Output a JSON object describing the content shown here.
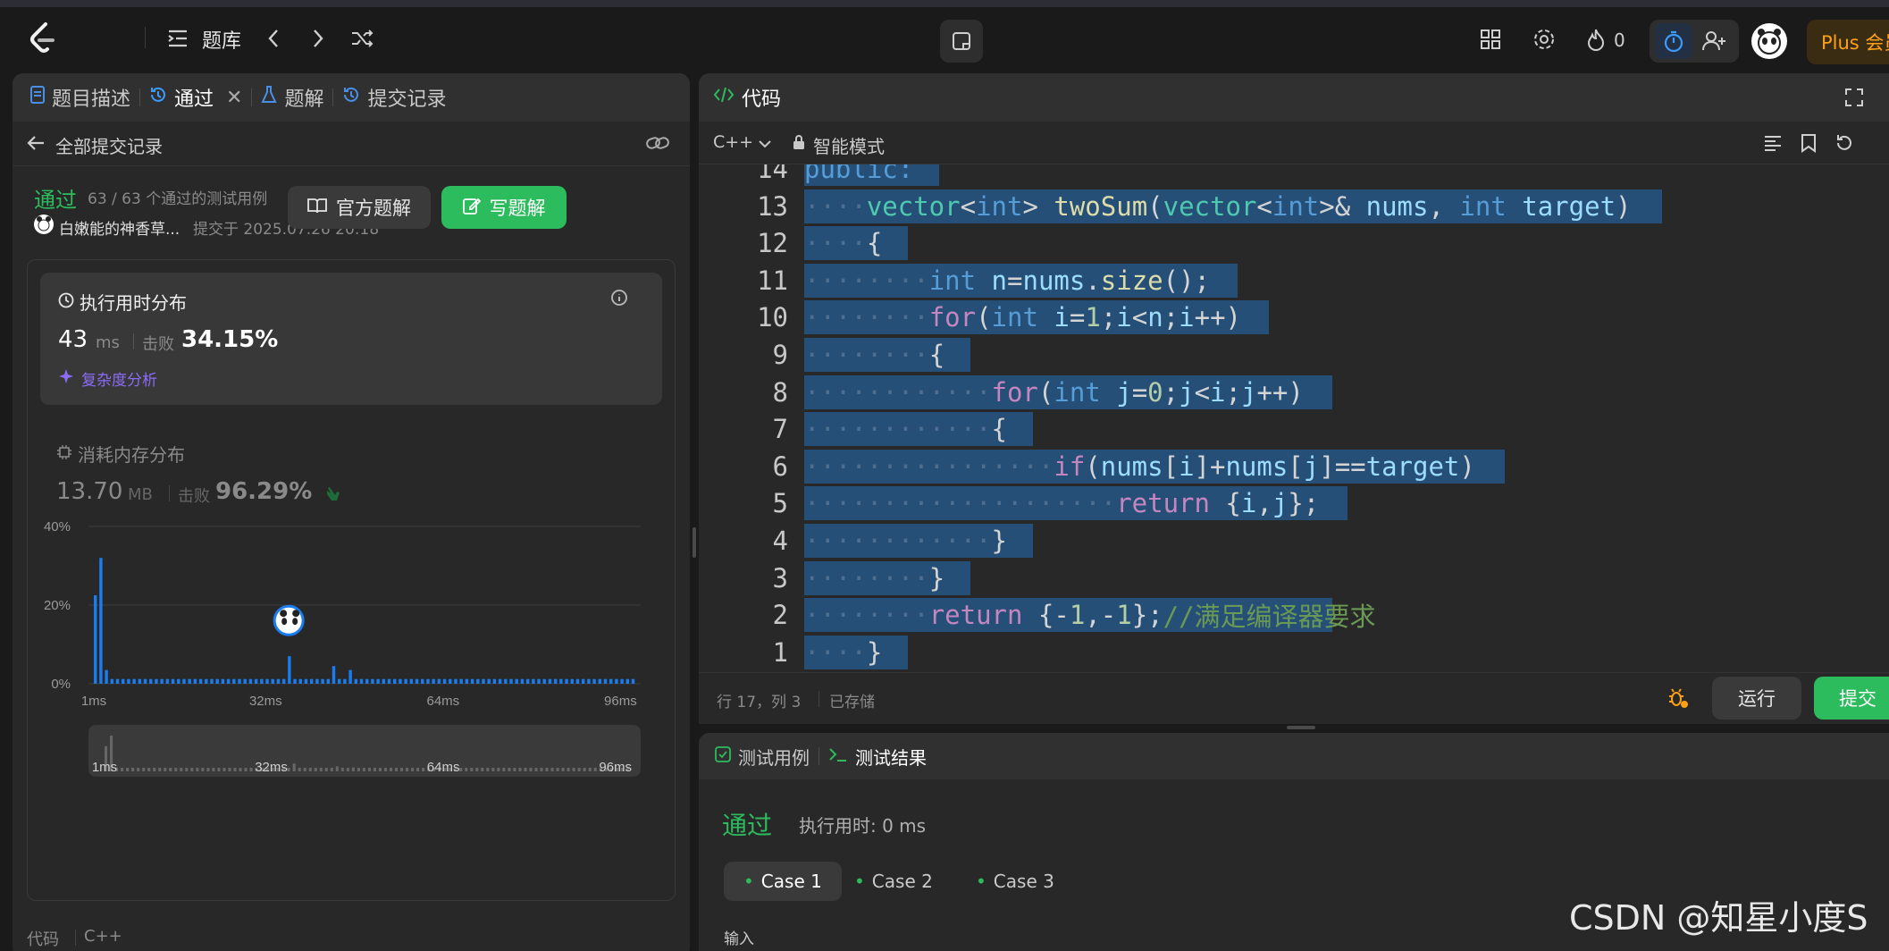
{
  "nav": {
    "problem_bank": "题库",
    "fire_count": "0",
    "plus": "Plus 会员"
  },
  "left": {
    "tabs": {
      "description": "题目描述",
      "accepted": "通过",
      "solutions": "题解",
      "submissions": "提交记录"
    },
    "back_label": "全部提交记录",
    "status": "通过",
    "cases_passed": "63 / 63 个通过的测试用例",
    "user": "白嫩能的神香草...",
    "submitted_at": "提交于 2025.07.26 20:18",
    "official_solution": "官方题解",
    "write_solution": "写题解",
    "runtime": {
      "title": "执行用时分布",
      "value": "43",
      "unit": "ms",
      "beats_label": "击败",
      "beats": "34.15%",
      "analysis": "复杂度分析"
    },
    "memory": {
      "title": "消耗内存分布",
      "value": "13.70",
      "unit": "MB",
      "beats_label": "击败",
      "beats": "96.29%"
    },
    "bottom_code_label": "代码",
    "bottom_lang": "C++"
  },
  "chart_data": {
    "type": "bar",
    "title": "执行用时分布",
    "yticks": [
      "40%",
      "20%",
      "0%"
    ],
    "xticks": [
      "1ms",
      "32ms",
      "64ms",
      "96ms"
    ],
    "ylim": [
      0,
      40
    ],
    "values": [
      22.5,
      32,
      3.5,
      1.2,
      1.2,
      1.2,
      1.2,
      1.2,
      1.2,
      1.2,
      1.2,
      1.2,
      1.2,
      1.2,
      1.2,
      1.2,
      1.2,
      1.2,
      1.2,
      1.2,
      1.2,
      1.2,
      1.2,
      1.2,
      1.2,
      1.2,
      1.2,
      1.2,
      1.2,
      1.2,
      1.2,
      1.2,
      1.2,
      1.2,
      1.2,
      7,
      1.2,
      1.2,
      1.2,
      1.2,
      1.2,
      1.2,
      1.2,
      4.5,
      1.2,
      1.2,
      3.5,
      1.2,
      1.2,
      1.2,
      1.2,
      1.2,
      1.2,
      1.2,
      1.2,
      1.2,
      1.2,
      1.2,
      1.2,
      1.2,
      1.2,
      1.2,
      1.2,
      1.2,
      1.2,
      1.2,
      1.2,
      1.2,
      1.2,
      1.2,
      1.2,
      1.2,
      1.2,
      1.2,
      1.2,
      1.2,
      1.2,
      1.2,
      1.2,
      1.2,
      1.2,
      1.2,
      1.2,
      1.2,
      1.2,
      1.2,
      1.2,
      1.2,
      1.2,
      1.2,
      1.2,
      1.2,
      1.2,
      1.2,
      1.2,
      1.2,
      1.2,
      1.2
    ],
    "highlight_index": 35,
    "colors": {
      "bar": "#1b7cf0",
      "grid": "#3d3d3d"
    }
  },
  "code": {
    "title": "代码",
    "lang": "C++",
    "mode": "智能模式",
    "lines": [
      {
        "n": "14",
        "indent": 0,
        "tokens": [
          [
            "kw",
            "public:"
          ]
        ]
      },
      {
        "n": "13",
        "indent": 1,
        "tokens": [
          [
            "tp",
            "vector"
          ],
          [
            "pl",
            "<"
          ],
          [
            "kw",
            "int"
          ],
          [
            "pl",
            "> "
          ],
          [
            "fn",
            "twoSum"
          ],
          [
            "pl",
            "("
          ],
          [
            "tp",
            "vector"
          ],
          [
            "pl",
            "<"
          ],
          [
            "kw",
            "int"
          ],
          [
            "pl",
            ">& "
          ],
          [
            "vr",
            "nums"
          ],
          [
            "pl",
            ", "
          ],
          [
            "kw",
            "int"
          ],
          [
            "pl",
            " "
          ],
          [
            "vr",
            "target"
          ],
          [
            "pl",
            ")"
          ]
        ]
      },
      {
        "n": "12",
        "indent": 1,
        "tokens": [
          [
            "pl",
            "{"
          ]
        ]
      },
      {
        "n": "11",
        "indent": 2,
        "tokens": [
          [
            "kw",
            "int"
          ],
          [
            "pl",
            " "
          ],
          [
            "vr",
            "n"
          ],
          [
            "pl",
            "="
          ],
          [
            "vr",
            "nums"
          ],
          [
            "pl",
            "."
          ],
          [
            "fn",
            "size"
          ],
          [
            "pl",
            "();"
          ]
        ]
      },
      {
        "n": "10",
        "indent": 2,
        "tokens": [
          [
            "ctl",
            "for"
          ],
          [
            "pl",
            "("
          ],
          [
            "kw",
            "int"
          ],
          [
            "pl",
            " "
          ],
          [
            "vr",
            "i"
          ],
          [
            "pl",
            "="
          ],
          [
            "num",
            "1"
          ],
          [
            "pl",
            ";"
          ],
          [
            "vr",
            "i"
          ],
          [
            "pl",
            "<"
          ],
          [
            "vr",
            "n"
          ],
          [
            "pl",
            ";"
          ],
          [
            "vr",
            "i"
          ],
          [
            "pl",
            "++)"
          ]
        ]
      },
      {
        "n": "9",
        "indent": 2,
        "tokens": [
          [
            "pl",
            "{"
          ]
        ]
      },
      {
        "n": "8",
        "indent": 3,
        "tokens": [
          [
            "ctl",
            "for"
          ],
          [
            "pl",
            "("
          ],
          [
            "kw",
            "int"
          ],
          [
            "pl",
            " "
          ],
          [
            "vr",
            "j"
          ],
          [
            "pl",
            "="
          ],
          [
            "num",
            "0"
          ],
          [
            "pl",
            ";"
          ],
          [
            "vr",
            "j"
          ],
          [
            "pl",
            "<"
          ],
          [
            "vr",
            "i"
          ],
          [
            "pl",
            ";"
          ],
          [
            "vr",
            "j"
          ],
          [
            "pl",
            "++)"
          ]
        ]
      },
      {
        "n": "7",
        "indent": 3,
        "tokens": [
          [
            "pl",
            "{"
          ]
        ]
      },
      {
        "n": "6",
        "indent": 4,
        "tokens": [
          [
            "ctl",
            "if"
          ],
          [
            "pl",
            "("
          ],
          [
            "vr",
            "nums"
          ],
          [
            "pl",
            "["
          ],
          [
            "vr",
            "i"
          ],
          [
            "pl",
            "]+"
          ],
          [
            "vr",
            "nums"
          ],
          [
            "pl",
            "["
          ],
          [
            "vr",
            "j"
          ],
          [
            "pl",
            "]=="
          ],
          [
            "vr",
            "target"
          ],
          [
            "pl",
            ")"
          ]
        ]
      },
      {
        "n": "5",
        "indent": 5,
        "tokens": [
          [
            "ctl",
            "return"
          ],
          [
            "pl",
            " {"
          ],
          [
            "vr",
            "i"
          ],
          [
            "pl",
            ","
          ],
          [
            "vr",
            "j"
          ],
          [
            "pl",
            "};"
          ]
        ]
      },
      {
        "n": "4",
        "indent": 3,
        "tokens": [
          [
            "pl",
            "}"
          ]
        ]
      },
      {
        "n": "3",
        "indent": 2,
        "tokens": [
          [
            "pl",
            "}"
          ]
        ]
      },
      {
        "n": "2",
        "indent": 2,
        "tokens": [
          [
            "ctl",
            "return"
          ],
          [
            "pl",
            " {-"
          ],
          [
            "num",
            "1"
          ],
          [
            "pl",
            ",-"
          ],
          [
            "num",
            "1"
          ],
          [
            "pl",
            "};"
          ],
          [
            "cm",
            "//满足编译器要求"
          ]
        ]
      },
      {
        "n": "1",
        "indent": 1,
        "tokens": [
          [
            "pl",
            "}"
          ]
        ]
      }
    ],
    "status_pos": "行 17，列 3",
    "saved": "已存储",
    "run": "运行",
    "submit": "提交"
  },
  "result": {
    "tab_cases": "测试用例",
    "tab_result": "测试结果",
    "status": "通过",
    "runtime": "执行用时: 0 ms",
    "cases": [
      "Case 1",
      "Case 2",
      "Case 3"
    ],
    "input_label": "输入"
  },
  "watermark": "CSDN @知星小度S"
}
